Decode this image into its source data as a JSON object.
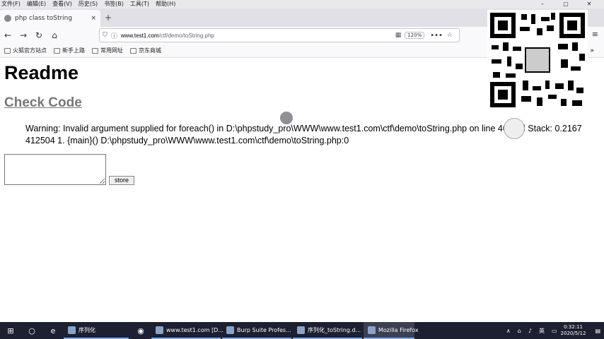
{
  "menubar": {
    "items": [
      "文件(F)",
      "编辑(E)",
      "查看(V)",
      "历史(S)",
      "书签(B)",
      "工具(T)",
      "帮助(H)"
    ]
  },
  "tab": {
    "title": "php class toString",
    "close": "×",
    "new_tab": "+"
  },
  "nav": {
    "back": "←",
    "forward": "→",
    "reload": "↻",
    "home": "⌂",
    "url_domain": "www.test1.com",
    "url_path": "/ctf/demo/toString.php",
    "zoom": "120%",
    "more": "•••",
    "menu": "≡"
  },
  "bookmarks": [
    "火狐官方站点",
    "新手上路",
    "常用网址",
    "京东商城"
  ],
  "page": {
    "heading": "Readme",
    "check_code": "Check Code",
    "warning": "Warning: Invalid argument supplied for foreach() in D:\\phpstudy_pro\\WWW\\www.test1.com\\ctf\\demo\\toString.php on line 40 Call Stack: 0.2167 412504 1. {main}() D:\\phpstudy_pro\\WWW\\www.test1.com\\ctf\\demo\\toString.php:0",
    "textarea_value": "",
    "store_button": "store"
  },
  "taskbar": {
    "apps": [
      {
        "label": "序列化",
        "active": false
      },
      {
        "label": "www.test1.com [D...",
        "active": false
      },
      {
        "label": "Burp Suite Profes...",
        "active": false
      },
      {
        "label": "序列化_toString.d...",
        "active": false
      },
      {
        "label": "Mozilla Firefox",
        "active": true
      }
    ],
    "ime": "英",
    "time": "0:32:11",
    "date": "2020/5/12"
  }
}
